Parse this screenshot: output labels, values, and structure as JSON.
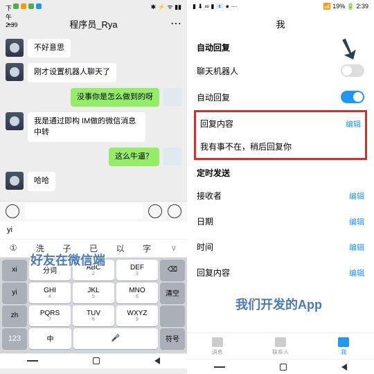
{
  "left": {
    "status": {
      "time": "下午2:39",
      "icons": [
        "green",
        "orange",
        "green",
        "blue"
      ],
      "signal": "✱ ⚡ ᯤ ▮▮"
    },
    "header": {
      "back": "←",
      "title": "程序员_Rya",
      "more": "⋯"
    },
    "messages": [
      {
        "from": "bot",
        "text": "不好意思"
      },
      {
        "from": "bot",
        "text": "刚才设置机器人聊天了"
      },
      {
        "from": "user",
        "text": "没事你是怎么做到的呀"
      },
      {
        "from": "bot",
        "text": "我是通过即构 IM做的微信消息中转"
      },
      {
        "from": "user",
        "text": "这么牛逼？"
      },
      {
        "from": "bot",
        "text": "哈哈"
      }
    ],
    "candidate_text": "yi",
    "candidates": [
      "①",
      "洗",
      "子",
      "已",
      "以",
      "字"
    ],
    "keyboard": {
      "r1": [
        {
          "m": "分词",
          "s": ""
        },
        {
          "m": "ABC",
          "s": "2"
        },
        {
          "m": "DEF",
          "s": "3"
        }
      ],
      "r2": [
        {
          "m": "GHI",
          "s": "4"
        },
        {
          "m": "JKL",
          "s": "5"
        },
        {
          "m": "MNO",
          "s": "6"
        }
      ],
      "r3": [
        {
          "m": "PQRS",
          "s": "7"
        },
        {
          "m": "TUV",
          "s": "8"
        },
        {
          "m": "WXYZ",
          "s": "9"
        }
      ],
      "side": [
        "xi",
        "yi",
        "zh",
        "",
        "",
        "123"
      ],
      "side_r": [
        "⌫",
        "清空",
        "",
        "",
        "",
        "符号"
      ],
      "bottom": [
        "中",
        ".",
        "🎤",
        "符号"
      ]
    }
  },
  "right": {
    "status": {
      "left": "▮ ⬇ ∞ ▮ 📧 ● ⋯",
      "right": "📶 19% 🔋 2:39"
    },
    "title": "我",
    "section1": "自动回复",
    "rows1": [
      {
        "label": "聊天机器人",
        "type": "toggle",
        "on": false
      },
      {
        "label": "自动回复",
        "type": "toggle",
        "on": true
      }
    ],
    "redbox": [
      {
        "label": "回复内容",
        "action": "编辑"
      },
      {
        "label": "我有事不在，稍后回复你",
        "action": ""
      }
    ],
    "section2": "定时发送",
    "rows2": [
      {
        "label": "接收者",
        "action": "编辑"
      },
      {
        "label": "日期",
        "action": "编辑"
      },
      {
        "label": "时间",
        "action": "编辑"
      },
      {
        "label": "回复内容",
        "action": "编辑"
      }
    ],
    "nav": [
      {
        "label": "消息",
        "active": false
      },
      {
        "label": "联系人",
        "active": false
      },
      {
        "label": "我",
        "active": true
      }
    ]
  },
  "overlays": {
    "left_text": "好友在微信端",
    "right_text": "我们开发的App"
  }
}
